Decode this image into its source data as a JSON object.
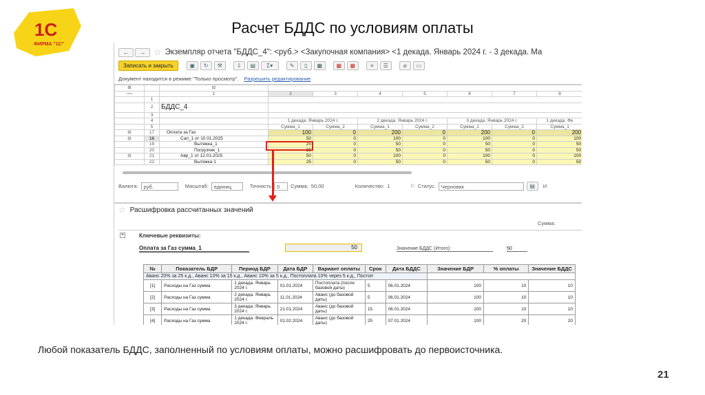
{
  "slide": {
    "title": "Расчет БДДС по условиям оплаты",
    "caption": "Любой показатель БДДС, заполненный по условиям оплаты, можно расшифровать до первоисточника.",
    "page": "21",
    "logo_text": "1С ФИРМА \"1С\""
  },
  "window": {
    "title": "Экземпляр отчета \"БДДС_4\": <руб.> <Закупочная компания> <1 декада. Январь 2024 г. - 3 декада. Ма",
    "save_close": "Записать и закрыть",
    "mode_text": "Документ находится в режиме \"Только просмотр\".",
    "allow_edit": "Разрешить редактирование"
  },
  "grid": {
    "col_numbers": [
      "1",
      "2",
      "3",
      "4",
      "5",
      "6",
      "7",
      "8"
    ],
    "report_name": "БДДС_4",
    "periods": [
      "1 декада. Январь 2024 г.",
      "2 декада. Январь 2024 г.",
      "3 декада. Январь 2024 г.",
      "1 декада. Фе"
    ],
    "sub_headers": [
      "Сумма_1",
      "Сумма_2",
      "Сумма_1",
      "Сумма_2",
      "Сумма_1",
      "Сумма_2",
      "Сумма_1"
    ],
    "rows": [
      {
        "n": "17",
        "label": "Оплата за Газ",
        "values": [
          "100",
          "0",
          "200",
          "0",
          "200",
          "0",
          "200"
        ]
      },
      {
        "n": "18",
        "label": "Сап_1 от 10.01.2025",
        "values": [
          "50",
          "0",
          "100",
          "0",
          "100",
          "0",
          "100"
        ]
      },
      {
        "n": "19",
        "label": "Вытяжка_1",
        "values": [
          "25",
          "0",
          "50",
          "0",
          "50",
          "0",
          "50"
        ]
      },
      {
        "n": "20",
        "label": "Погрузчик_1",
        "values": [
          "25",
          "0",
          "50",
          "0",
          "50",
          "0",
          "50"
        ]
      },
      {
        "n": "21",
        "label": "Авр_1 от 12.01.2025",
        "values": [
          "50",
          "0",
          "100",
          "0",
          "100",
          "0",
          "100"
        ]
      },
      {
        "n": "22",
        "label": "Вытяжка 1",
        "values": [
          "25",
          "0",
          "50",
          "0",
          "50",
          "0",
          "50"
        ]
      }
    ]
  },
  "footer": {
    "currency_label": "Валюта:",
    "currency": "руб.",
    "scale_label": "Масштаб:",
    "scale": "единиц",
    "precision_label": "Точность",
    "precision": "0",
    "sum_label": "Сумма:",
    "sum": "50,00",
    "qty_label": "Количество:",
    "qty": "1",
    "status_label": "Статус:",
    "status": "Черновик",
    "extra": "И"
  },
  "detail": {
    "title": "Расшифровка рассчитанных значений",
    "sum_label": "Сумма:",
    "key_label": "Ключевые реквизиты:",
    "field_label": "Оплата за Газ сумма_1",
    "field_value": "50",
    "total_label": "Значение БДДС (Итого):",
    "total_value": "50",
    "headers": [
      "№",
      "Показатель БДР",
      "Период БДР",
      "Дата БДР",
      "Вариант оплаты",
      "Срок",
      "Дата БДДС",
      "Значение БДР",
      "% оплаты",
      "Значение БДДС"
    ],
    "terms": "Аванс 20% за 25 к.д., Аванс 10% за 15 к.д., Аванс 10% за 5 к.д., Постоплата 10% через 5 к.д., Постоп",
    "rows": [
      [
        "[1]",
        "Расходы на Газ сумма",
        "1 декада. Январь 2024 г.",
        "01.01.2024",
        "Постоплата (после базовой даты)",
        "5",
        "06.01.2024",
        "100",
        "10",
        "10"
      ],
      [
        "[2]",
        "Расходы на Газ сумма",
        "2 декада. Январь 2024 г.",
        "11.01.2024",
        "Аванс (до базовой даты)",
        "5",
        "06.01.2024",
        "100",
        "10",
        "10"
      ],
      [
        "[3]",
        "Расходы на Газ сумма",
        "3 декада. Январь 2024 г.",
        "21.01.2024",
        "Аванс (до базовой даты)",
        "15",
        "06.01.2024",
        "100",
        "10",
        "10"
      ],
      [
        "[4]",
        "Расходы на Газ сумма",
        "1 декада. Февраль 2024 г.",
        "01.02.2024",
        "Аванс (до базовой даты)",
        "25",
        "07.01.2024",
        "100",
        "20",
        "20"
      ]
    ]
  },
  "colors": {
    "accent": "#f6d22a",
    "highlight": "#e0201a",
    "cell": "#fbf7b5"
  }
}
